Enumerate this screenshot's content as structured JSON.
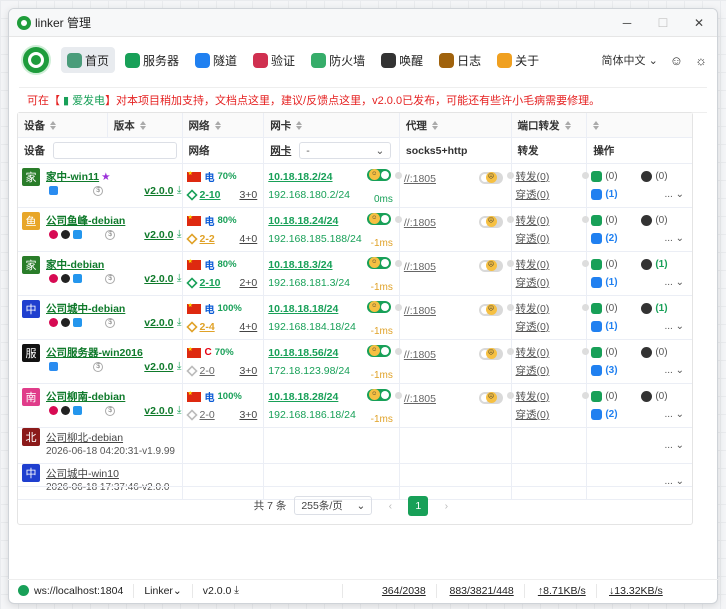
{
  "window": {
    "title": "linker 管理",
    "controls": [
      "─",
      "☐",
      "✕"
    ]
  },
  "nav": {
    "items": [
      {
        "label": "首页",
        "color": "#4a9c7a",
        "active": true,
        "icon": "home-icon"
      },
      {
        "label": "服务器",
        "color": "#18a058",
        "icon": "cloud-icon"
      },
      {
        "label": "隧道",
        "color": "#2080f0",
        "icon": "tunnel-icon"
      },
      {
        "label": "验证",
        "color": "#d03050",
        "icon": "verify-icon"
      },
      {
        "label": "防火墙",
        "color": "#36ad6a",
        "icon": "shield-icon"
      },
      {
        "label": "唤醒",
        "color": "#333333",
        "icon": "play-icon"
      },
      {
        "label": "日志",
        "color": "#a0620c",
        "icon": "log-icon"
      },
      {
        "label": "关于",
        "color": "#f0a020",
        "icon": "about-icon"
      }
    ],
    "language": "简体中文"
  },
  "notice": {
    "p1": "可在【",
    "p2": "爱发电",
    "p3": "】对本项目稍加支持，文档点这里，建议/反馈点这里，v2.0.0已发布，可能还有些许小毛病需要修理。"
  },
  "headers": {
    "device": "设备",
    "version": "版本",
    "network": "网络",
    "nic": "网卡",
    "proxy": "代理",
    "portfwd": "端口转发",
    "ops": "操作",
    "sub_device": "设备",
    "sub_network": "网络",
    "sub_nic": "网卡",
    "sub_nic_sel": "-",
    "sub_proxy": "socks5+http",
    "sub_fwd": "转发",
    "sub_ops": "操作"
  },
  "rows": [
    {
      "avatar": "家",
      "av_color": "#2a7d2a",
      "name": "家中-win11",
      "star": true,
      "os": "windows",
      "ver": "v2.0.0",
      "isp": "电",
      "pct": "70%",
      "netlink": "2-10",
      "netcls": "",
      "count": "3+0",
      "ip": "10.18.18.2/24",
      "ip2": "192.168.180.2/24",
      "ms": "0ms",
      "msg": true,
      "proxy": "//:1805",
      "fwd": "转发(0)",
      "pen": "穿透(0)",
      "o1": "(0)",
      "o2": "(0)",
      "o3": "(1)",
      "o4": "",
      "o3c": "b"
    },
    {
      "avatar": "鱼",
      "av_color": "#e8a628",
      "name": "公司鱼峰-debian",
      "os": "linux",
      "ver": "v2.0.0",
      "isp": "电",
      "pct": "80%",
      "netlink": "2-2",
      "netcls": "or",
      "count": "4+0",
      "ip": "10.18.18.24/24",
      "ip2": "192.168.185.188/24",
      "ms": "-1ms",
      "proxy": "//:1805",
      "fwd": "转发(0)",
      "pen": "穿透(0)",
      "o1": "(0)",
      "o2": "(0)",
      "o3": "(2)",
      "o3c": "b"
    },
    {
      "avatar": "家",
      "av_color": "#2a7d2a",
      "name": "家中-debian",
      "os": "linux",
      "ver": "v2.0.0",
      "isp": "电",
      "pct": "80%",
      "netlink": "2-10",
      "netcls": "",
      "count": "2+0",
      "ip": "10.18.18.3/24",
      "ip2": "192.168.181.3/24",
      "ms": "-1ms",
      "proxy": "//:1805",
      "fwd": "转发(0)",
      "pen": "穿透(0)",
      "o1": "(0)",
      "o2": "(1)",
      "o2c": "gn",
      "o3": "(1)",
      "o3c": "b"
    },
    {
      "avatar": "中",
      "av_color": "#1f3fcf",
      "name": "公司城中-debian",
      "os": "linux",
      "ver": "v2.0.0",
      "isp": "电",
      "pct": "100%",
      "netlink": "2-4",
      "netcls": "or",
      "count": "4+0",
      "ip": "10.18.18.18/24",
      "ip2": "192.168.184.18/24",
      "ms": "-1ms",
      "proxy": "//:1805",
      "fwd": "转发(0)",
      "pen": "穿透(0)",
      "o1": "(0)",
      "o2": "(1)",
      "o2c": "gn",
      "o3": "(1)",
      "o3c": "b"
    },
    {
      "avatar": "服",
      "av_color": "#111111",
      "name": "公司服务器-win2016",
      "os": "windows",
      "ver": "v2.0.0",
      "isp": "C",
      "ispcu": true,
      "pct": "70%",
      "netlink": "2-0",
      "netcls": "gr",
      "count": "3+0",
      "ip": "10.18.18.56/24",
      "ip2": "172.18.123.98/24",
      "ms": "-1ms",
      "proxy": "//:1805",
      "fwd": "转发(0)",
      "pen": "穿透(0)",
      "o1": "(0)",
      "o2": "(0)",
      "o3": "(3)",
      "o3c": "b"
    },
    {
      "avatar": "南",
      "av_color": "#e03c8a",
      "name": "公司柳南-debian",
      "os": "linux",
      "ver": "v2.0.0",
      "isp": "电",
      "pct": "100%",
      "netlink": "2-0",
      "netcls": "gr",
      "count": "3+0",
      "ip": "10.18.18.28/24",
      "ip2": "192.168.186.18/24",
      "ms": "-1ms",
      "proxy": "//:1805",
      "fwd": "转发(0)",
      "pen": "穿透(0)",
      "o1": "(0)",
      "o2": "(0)",
      "o3": "(2)",
      "o3c": "b"
    }
  ],
  "offline": [
    {
      "avatar": "北",
      "av_color": "#8b1a1a",
      "name": "公司柳北-debian",
      "sub": "2026-06-18 04:20:31-v1.9.99"
    },
    {
      "avatar": "中",
      "av_color": "#1f3fcf",
      "name": "公司城中-win10",
      "sub": "2026-06-18 17:37:46-v2.0.0"
    }
  ],
  "more": "...",
  "pager": {
    "total": "共 7 条",
    "size": "255条/页",
    "page": "1"
  },
  "status": {
    "ws": "ws://localhost:1804",
    "app": "Linker",
    "ver": "v2.0.0",
    "a": "364/2038",
    "b": "883/3821/448",
    "up": "↑8.71KB/s",
    "down": "↓13.32KB/s"
  }
}
